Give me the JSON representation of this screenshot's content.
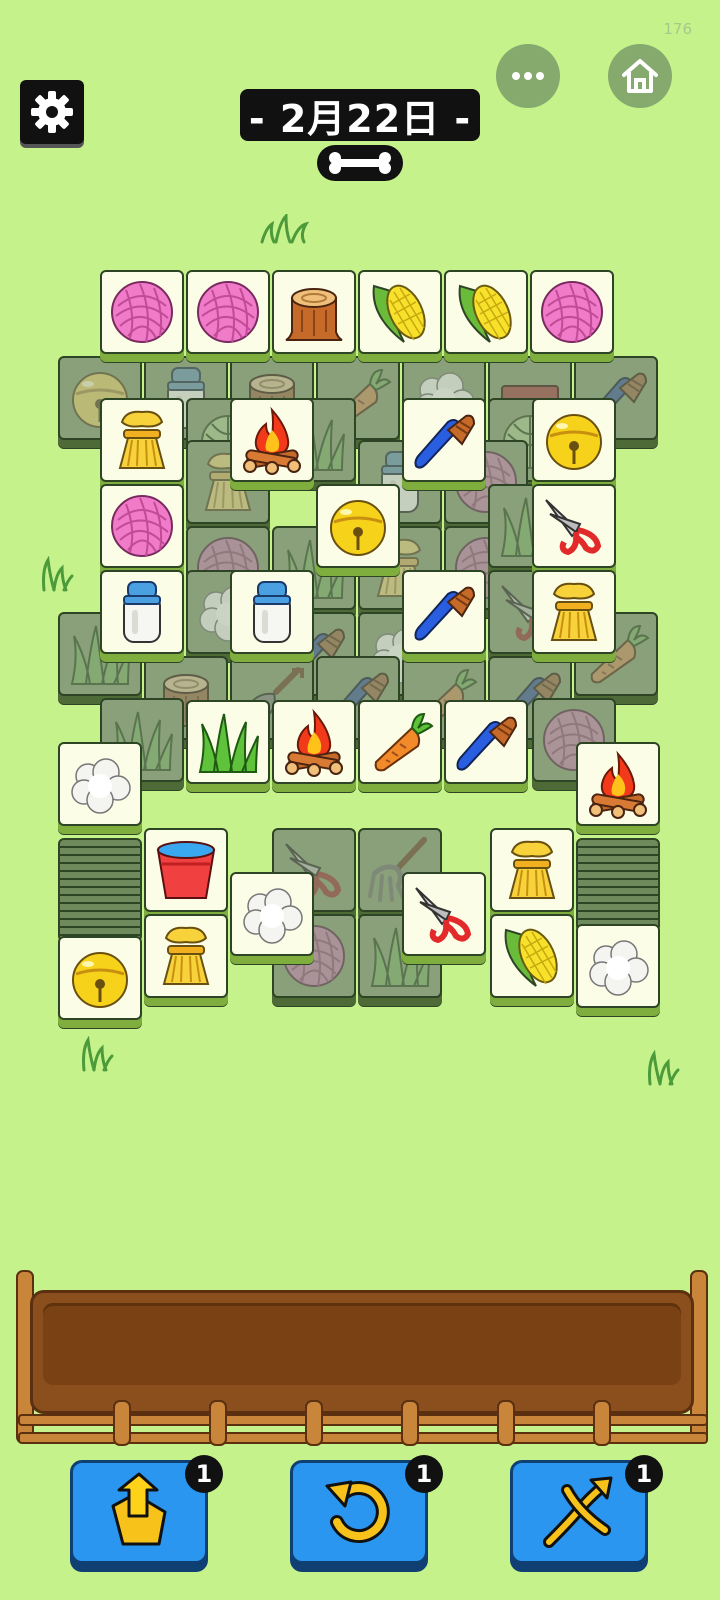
{
  "status": {
    "corner_number": "176"
  },
  "header": {
    "date_title": "- 2月22日 -"
  },
  "tiles_board": "mahjong-style matching board",
  "tools": [
    {
      "name": "take-out",
      "count": "1"
    },
    {
      "name": "undo",
      "count": "1"
    },
    {
      "name": "shuffle",
      "count": "1"
    }
  ]
}
